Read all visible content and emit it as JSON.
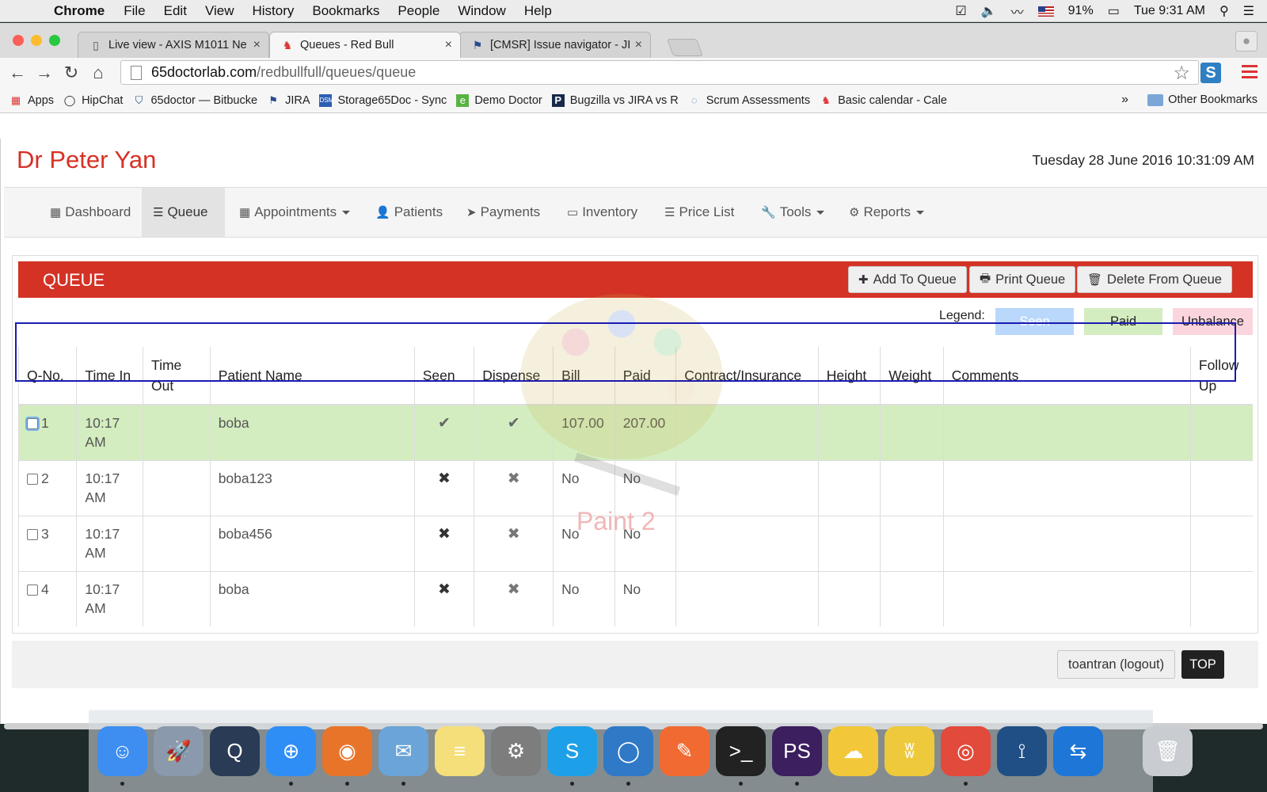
{
  "menubar": {
    "app": "Chrome",
    "items": [
      "File",
      "Edit",
      "View",
      "History",
      "Bookmarks",
      "People",
      "Window",
      "Help"
    ],
    "battery": "91%",
    "clock": "Tue 9:31 AM"
  },
  "browser": {
    "tabs": [
      {
        "title": "Live view - AXIS M1011 Ne",
        "icon": "page-icon"
      },
      {
        "title": "Queues - Red Bull",
        "icon": "redbull-icon"
      },
      {
        "title": "[CMSR] Issue navigator - JI",
        "icon": "jira-icon"
      }
    ],
    "url_host": "65doctorlab.com",
    "url_path": "/redbullfull/queues/queue",
    "bookmarks": [
      {
        "label": "Apps",
        "icon": "apps-grid-icon"
      },
      {
        "label": "HipChat",
        "icon": "hipchat-icon"
      },
      {
        "label": "65doctor — Bitbucke",
        "icon": "bitbucket-icon"
      },
      {
        "label": "JIRA",
        "icon": "jira-icon"
      },
      {
        "label": "Storage65Doc - Sync",
        "icon": "dsm-icon"
      },
      {
        "label": "Demo Doctor",
        "icon": "evernote-icon"
      },
      {
        "label": "Bugzilla vs JIRA vs R",
        "icon": "p-icon"
      },
      {
        "label": "Scrum Assessments",
        "icon": "scrum-icon"
      },
      {
        "label": "Basic calendar - Cale",
        "icon": "redbull-icon"
      }
    ],
    "other_bookmarks": "Other Bookmarks",
    "more_chevron": "»"
  },
  "header": {
    "doctor": "Dr Peter Yan",
    "datetime": "Tuesday 28 June 2016 10:31:09 AM"
  },
  "nav": [
    {
      "label": "Dashboard",
      "icon": "calendar-icon",
      "dropdown": false,
      "active": false
    },
    {
      "label": "Queue",
      "icon": "list-icon",
      "dropdown": false,
      "active": true
    },
    {
      "label": "Appointments",
      "icon": "calendar-icon",
      "dropdown": true,
      "active": false
    },
    {
      "label": "Patients",
      "icon": "user-icon",
      "dropdown": false,
      "active": false
    },
    {
      "label": "Payments",
      "icon": "send-icon",
      "dropdown": false,
      "active": false
    },
    {
      "label": "Inventory",
      "icon": "folder-open-icon",
      "dropdown": false,
      "active": false
    },
    {
      "label": "Price List",
      "icon": "list-icon",
      "dropdown": false,
      "active": false
    },
    {
      "label": "Tools",
      "icon": "wrench-icon",
      "dropdown": true,
      "active": false
    },
    {
      "label": "Reports",
      "icon": "gear-icon",
      "dropdown": true,
      "active": false
    }
  ],
  "queue": {
    "title": "QUEUE",
    "buttons": {
      "add": "Add To Queue",
      "print": "Print Queue",
      "delete": "Delete From Queue"
    },
    "legend_label": "Legend:",
    "legend": [
      {
        "label": "Seen",
        "bg": "#b9d8fb",
        "fg": "#ffffff"
      },
      {
        "label": "Paid",
        "bg": "#d4edc0",
        "fg": "#222222"
      },
      {
        "label": "Unbalance",
        "bg": "#fbd5de",
        "fg": "#222222"
      }
    ],
    "columns": [
      "Q-No.",
      "Time In",
      "Time Out",
      "Patient Name",
      "Seen",
      "Dispense",
      "Bill",
      "Paid",
      "Contract/Insurance",
      "Height",
      "Weight",
      "Comments",
      "Follow Up"
    ],
    "rows": [
      {
        "qno": "1",
        "time_in": "10:17 AM",
        "time_out": "",
        "patient": "boba",
        "seen": "✔",
        "dispense": "✔",
        "bill": "107.00",
        "paid": "207.00",
        "contract": "",
        "height": "",
        "weight": "",
        "comments": "",
        "follow_up": "",
        "status": "paid"
      },
      {
        "qno": "2",
        "time_in": "10:17 AM",
        "time_out": "",
        "patient": "boba123",
        "seen": "✖",
        "dispense": "✖",
        "bill": "No",
        "paid": "No",
        "contract": "",
        "height": "",
        "weight": "",
        "comments": "",
        "follow_up": "",
        "status": "none"
      },
      {
        "qno": "3",
        "time_in": "10:17 AM",
        "time_out": "",
        "patient": "boba456",
        "seen": "✖",
        "dispense": "✖",
        "bill": "No",
        "paid": "No",
        "contract": "",
        "height": "",
        "weight": "",
        "comments": "",
        "follow_up": "",
        "status": "none"
      },
      {
        "qno": "4",
        "time_in": "10:17 AM",
        "time_out": "",
        "patient": "boba",
        "seen": "✖",
        "dispense": "✖",
        "bill": "No",
        "paid": "No",
        "contract": "",
        "height": "",
        "weight": "",
        "comments": "",
        "follow_up": "",
        "status": "none"
      }
    ]
  },
  "watermark_text": "Paint 2",
  "footer": {
    "logout": "toantran (logout)",
    "top": "TOP"
  },
  "colors": {
    "brand_red": "#d33225",
    "doctor_name": "#d63125",
    "paid_row": "#d4edc0",
    "highlight": "#1b1bb0"
  },
  "dock": [
    "finder-icon",
    "launchpad-icon",
    "quicktime-icon",
    "safari-icon",
    "firefox-icon",
    "mail-icon",
    "notes-icon",
    "system-preferences-icon",
    "skype-icon",
    "hipchat-icon",
    "paw-icon",
    "terminal-icon",
    "phpstorm-icon",
    "jaxx-icon",
    "warp-icon",
    "chrome-icon",
    "sourcetree-icon",
    "teamviewer-icon",
    "trash-icon"
  ]
}
